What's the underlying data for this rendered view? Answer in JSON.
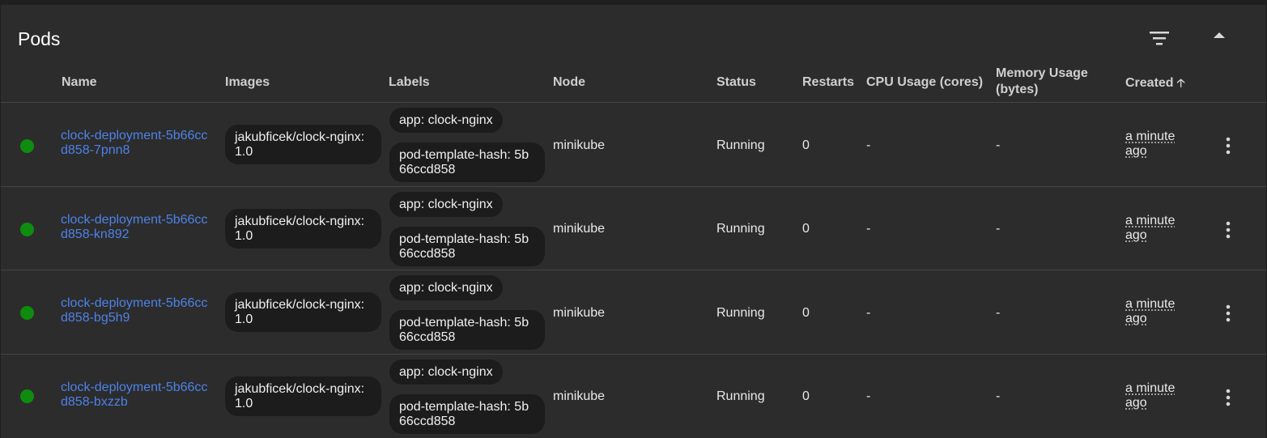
{
  "panel": {
    "title": "Pods",
    "filter_icon": "filter-icon",
    "collapse_icon": "collapse-up-icon"
  },
  "columns": {
    "name": "Name",
    "images": "Images",
    "labels": "Labels",
    "node": "Node",
    "status": "Status",
    "restarts": "Restarts",
    "cpu": "CPU Usage (cores)",
    "memory": "Memory Usage (bytes)",
    "created": "Created",
    "created_sort_icon": "arrow-up-icon"
  },
  "colors": {
    "status_running": "#0e8c0e",
    "link": "#4d82e8"
  },
  "pods": [
    {
      "name": "clock-deployment-5b66ccd858-7pnn8",
      "image": "jakubficek/clock-nginx:1.0",
      "label_app": "app: clock-nginx",
      "label_hash": "pod-template-hash: 5b66ccd858",
      "node": "minikube",
      "status": "Running",
      "restarts": "0",
      "cpu": "-",
      "memory": "-",
      "created": "a minute ago"
    },
    {
      "name": "clock-deployment-5b66ccd858-kn892",
      "image": "jakubficek/clock-nginx:1.0",
      "label_app": "app: clock-nginx",
      "label_hash": "pod-template-hash: 5b66ccd858",
      "node": "minikube",
      "status": "Running",
      "restarts": "0",
      "cpu": "-",
      "memory": "-",
      "created": "a minute ago"
    },
    {
      "name": "clock-deployment-5b66ccd858-bg5h9",
      "image": "jakubficek/clock-nginx:1.0",
      "label_app": "app: clock-nginx",
      "label_hash": "pod-template-hash: 5b66ccd858",
      "node": "minikube",
      "status": "Running",
      "restarts": "0",
      "cpu": "-",
      "memory": "-",
      "created": "a minute ago"
    },
    {
      "name": "clock-deployment-5b66ccd858-bxzzb",
      "image": "jakubficek/clock-nginx:1.0",
      "label_app": "app: clock-nginx",
      "label_hash": "pod-template-hash: 5b66ccd858",
      "node": "minikube",
      "status": "Running",
      "restarts": "0",
      "cpu": "-",
      "memory": "-",
      "created": "a minute ago"
    }
  ]
}
